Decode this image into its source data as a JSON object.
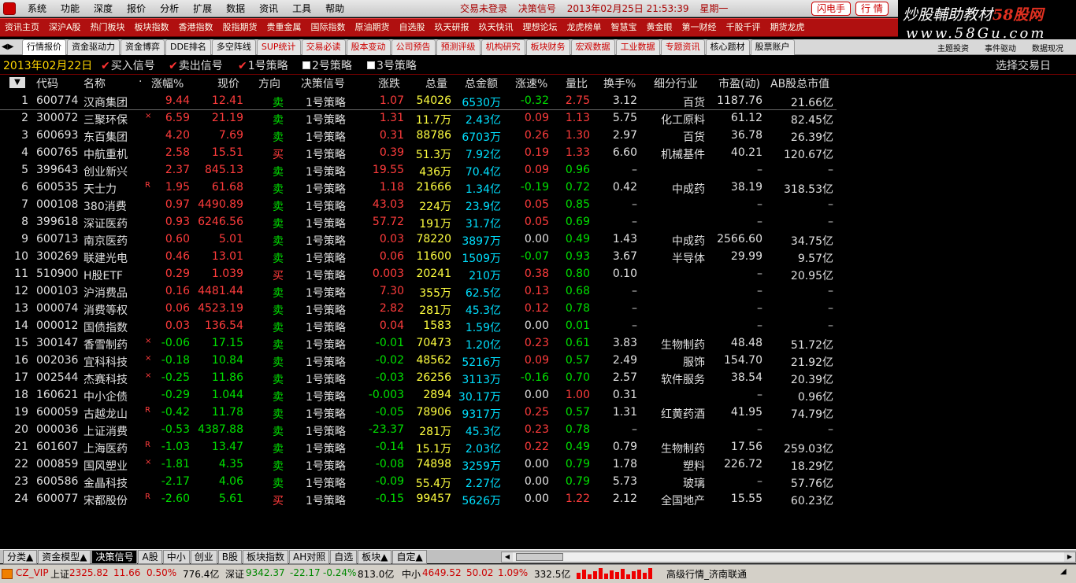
{
  "menu": [
    "系统",
    "功能",
    "深度",
    "报价",
    "分析",
    "扩展",
    "数据",
    "资讯",
    "工具",
    "帮助"
  ],
  "status": {
    "login": "交易未登录",
    "module": "决策信号",
    "datetime": "2013年02月25日  21:53:39",
    "weekday": "星期一"
  },
  "top_buttons": {
    "flash": "闪电手",
    "quote": "行 情"
  },
  "watermark": {
    "line1_a": "炒股輔助教材",
    "line1_b": "58股网",
    "line2": "www.58Gu.com"
  },
  "toolbar": [
    "资讯主页",
    "深沪A股",
    "热门板块",
    "板块指数",
    "香港指数",
    "股指期货",
    "贵重金属",
    "国际指数",
    "原油期货",
    "自选股",
    "玖天研报",
    "玖天快讯",
    "理想论坛",
    "龙虎榜单",
    "智慧宝",
    "黄金眼",
    "第一财经",
    "千股千评",
    "期货龙虎"
  ],
  "tabs": [
    "行情报价",
    "资金驱动力",
    "资金博弈",
    "DDE排名",
    "多空阵线",
    "SUP统计",
    "交易必读",
    "股本变动",
    "公司预告",
    "预测评级",
    "机构研究",
    "板块财务",
    "宏观数据",
    "工业数据",
    "专题资讯",
    "核心题材",
    "股票账户"
  ],
  "tabs_right": [
    "主题投资",
    "事件驱动",
    "数据现况"
  ],
  "dateline": {
    "date": "2013年02月22日",
    "buy": "买入信号",
    "sell": "卖出信号",
    "s1": "1号策略",
    "s2": "2号策略",
    "s3": "3号策略",
    "select_day": "选择交易日"
  },
  "headers": {
    "code": "代码",
    "name": "名称",
    "dot": "·",
    "pct": "涨幅%",
    "price": "现价",
    "dir": "方向",
    "signal": "决策信号",
    "chg": "涨跌",
    "vol": "总量",
    "amt": "总金额",
    "speed": "涨速%",
    "ratio": "量比",
    "turn": "换手%",
    "ind": "细分行业",
    "pe": "市盈(动)",
    "cap": "AB股总市值"
  },
  "rows": [
    {
      "n": "1",
      "code": "600774",
      "name": "汉商集团",
      "flag": "",
      "pct": "9.44",
      "price": "12.41",
      "dir": "卖",
      "sig": "1号策略",
      "chg": "1.07",
      "vol": "54026",
      "amt": "6530万",
      "speed": "-0.32",
      "ratio": "2.75",
      "turn": "3.12",
      "ind": "百货",
      "pe": "1187.76",
      "cap": "21.66亿"
    },
    {
      "n": "2",
      "code": "300072",
      "name": "三聚环保",
      "flag": "×",
      "pct": "6.59",
      "price": "21.19",
      "dir": "卖",
      "sig": "1号策略",
      "chg": "1.31",
      "vol": "11.7万",
      "amt": "2.43亿",
      "speed": "0.09",
      "ratio": "1.13",
      "turn": "5.75",
      "ind": "化工原料",
      "pe": "61.12",
      "cap": "82.45亿"
    },
    {
      "n": "3",
      "code": "600693",
      "name": "东百集团",
      "flag": "",
      "pct": "4.20",
      "price": "7.69",
      "dir": "卖",
      "sig": "1号策略",
      "chg": "0.31",
      "vol": "88786",
      "amt": "6703万",
      "speed": "0.26",
      "ratio": "1.30",
      "turn": "2.97",
      "ind": "百货",
      "pe": "36.78",
      "cap": "26.39亿"
    },
    {
      "n": "4",
      "code": "600765",
      "name": "中航重机",
      "flag": "",
      "pct": "2.58",
      "price": "15.51",
      "dir": "买",
      "sig": "1号策略",
      "chg": "0.39",
      "vol": "51.3万",
      "amt": "7.92亿",
      "speed": "0.19",
      "ratio": "1.33",
      "turn": "6.60",
      "ind": "机械基件",
      "pe": "40.21",
      "cap": "120.67亿"
    },
    {
      "n": "5",
      "code": "399643",
      "name": "创业新兴",
      "flag": "",
      "pct": "2.37",
      "price": "845.13",
      "dir": "卖",
      "sig": "1号策略",
      "chg": "19.55",
      "vol": "436万",
      "amt": "70.4亿",
      "speed": "0.09",
      "ratio": "0.96",
      "turn": "–",
      "ind": "",
      "pe": "–",
      "cap": "–"
    },
    {
      "n": "6",
      "code": "600535",
      "name": "天士力",
      "flag": "R",
      "pct": "1.95",
      "price": "61.68",
      "dir": "卖",
      "sig": "1号策略",
      "chg": "1.18",
      "vol": "21666",
      "amt": "1.34亿",
      "speed": "-0.19",
      "ratio": "0.72",
      "turn": "0.42",
      "ind": "中成药",
      "pe": "38.19",
      "cap": "318.53亿"
    },
    {
      "n": "7",
      "code": "000108",
      "name": "380消费",
      "flag": "",
      "pct": "0.97",
      "price": "4490.89",
      "dir": "卖",
      "sig": "1号策略",
      "chg": "43.03",
      "vol": "224万",
      "amt": "23.9亿",
      "speed": "0.05",
      "ratio": "0.85",
      "turn": "–",
      "ind": "",
      "pe": "–",
      "cap": "–"
    },
    {
      "n": "8",
      "code": "399618",
      "name": "深证医药",
      "flag": "",
      "pct": "0.93",
      "price": "6246.56",
      "dir": "卖",
      "sig": "1号策略",
      "chg": "57.72",
      "vol": "191万",
      "amt": "31.7亿",
      "speed": "0.05",
      "ratio": "0.69",
      "turn": "–",
      "ind": "",
      "pe": "–",
      "cap": "–"
    },
    {
      "n": "9",
      "code": "600713",
      "name": "南京医药",
      "flag": "",
      "pct": "0.60",
      "price": "5.01",
      "dir": "卖",
      "sig": "1号策略",
      "chg": "0.03",
      "vol": "78220",
      "amt": "3897万",
      "speed": "0.00",
      "ratio": "0.49",
      "turn": "1.43",
      "ind": "中成药",
      "pe": "2566.60",
      "cap": "34.75亿"
    },
    {
      "n": "10",
      "code": "300269",
      "name": "联建光电",
      "flag": "",
      "pct": "0.46",
      "price": "13.01",
      "dir": "卖",
      "sig": "1号策略",
      "chg": "0.06",
      "vol": "11600",
      "amt": "1509万",
      "speed": "-0.07",
      "ratio": "0.93",
      "turn": "3.67",
      "ind": "半导体",
      "pe": "29.99",
      "cap": "9.57亿"
    },
    {
      "n": "11",
      "code": "510900",
      "name": "H股ETF",
      "flag": "",
      "pct": "0.29",
      "price": "1.039",
      "dir": "买",
      "sig": "1号策略",
      "chg": "0.003",
      "vol": "20241",
      "amt": "210万",
      "speed": "0.38",
      "ratio": "0.80",
      "turn": "0.10",
      "ind": "",
      "pe": "–",
      "cap": "20.95亿"
    },
    {
      "n": "12",
      "code": "000103",
      "name": "沪消费品",
      "flag": "",
      "pct": "0.16",
      "price": "4481.44",
      "dir": "卖",
      "sig": "1号策略",
      "chg": "7.30",
      "vol": "355万",
      "amt": "62.5亿",
      "speed": "0.13",
      "ratio": "0.68",
      "turn": "–",
      "ind": "",
      "pe": "–",
      "cap": "–"
    },
    {
      "n": "13",
      "code": "000074",
      "name": "消费等权",
      "flag": "",
      "pct": "0.06",
      "price": "4523.19",
      "dir": "卖",
      "sig": "1号策略",
      "chg": "2.82",
      "vol": "281万",
      "amt": "45.3亿",
      "speed": "0.12",
      "ratio": "0.78",
      "turn": "–",
      "ind": "",
      "pe": "–",
      "cap": "–"
    },
    {
      "n": "14",
      "code": "000012",
      "name": "国债指数",
      "flag": "",
      "pct": "0.03",
      "price": "136.54",
      "dir": "卖",
      "sig": "1号策略",
      "chg": "0.04",
      "vol": "1583",
      "amt": "1.59亿",
      "speed": "0.00",
      "ratio": "0.01",
      "turn": "–",
      "ind": "",
      "pe": "–",
      "cap": "–"
    },
    {
      "n": "15",
      "code": "300147",
      "name": "香雪制药",
      "flag": "×",
      "pct": "-0.06",
      "price": "17.15",
      "dir": "卖",
      "sig": "1号策略",
      "chg": "-0.01",
      "vol": "70473",
      "amt": "1.20亿",
      "speed": "0.23",
      "ratio": "0.61",
      "turn": "3.83",
      "ind": "生物制药",
      "pe": "48.48",
      "cap": "51.72亿"
    },
    {
      "n": "16",
      "code": "002036",
      "name": "宜科科技",
      "flag": "×",
      "pct": "-0.18",
      "price": "10.84",
      "dir": "卖",
      "sig": "1号策略",
      "chg": "-0.02",
      "vol": "48562",
      "amt": "5216万",
      "speed": "0.09",
      "ratio": "0.57",
      "turn": "2.49",
      "ind": "服饰",
      "pe": "154.70",
      "cap": "21.92亿"
    },
    {
      "n": "17",
      "code": "002544",
      "name": "杰赛科技",
      "flag": "×",
      "pct": "-0.25",
      "price": "11.86",
      "dir": "卖",
      "sig": "1号策略",
      "chg": "-0.03",
      "vol": "26256",
      "amt": "3113万",
      "speed": "-0.16",
      "ratio": "0.70",
      "turn": "2.57",
      "ind": "软件服务",
      "pe": "38.54",
      "cap": "20.39亿"
    },
    {
      "n": "18",
      "code": "160621",
      "name": "中小企债",
      "flag": "",
      "pct": "-0.29",
      "price": "1.044",
      "dir": "卖",
      "sig": "1号策略",
      "chg": "-0.003",
      "vol": "2894",
      "amt": "30.17万",
      "speed": "0.00",
      "ratio": "1.00",
      "turn": "0.31",
      "ind": "",
      "pe": "–",
      "cap": "0.96亿"
    },
    {
      "n": "19",
      "code": "600059",
      "name": "古越龙山",
      "flag": "R",
      "pct": "-0.42",
      "price": "11.78",
      "dir": "卖",
      "sig": "1号策略",
      "chg": "-0.05",
      "vol": "78906",
      "amt": "9317万",
      "speed": "0.25",
      "ratio": "0.57",
      "turn": "1.31",
      "ind": "红黄药酒",
      "pe": "41.95",
      "cap": "74.79亿"
    },
    {
      "n": "20",
      "code": "000036",
      "name": "上证消费",
      "flag": "",
      "pct": "-0.53",
      "price": "4387.88",
      "dir": "卖",
      "sig": "1号策略",
      "chg": "-23.37",
      "vol": "281万",
      "amt": "45.3亿",
      "speed": "0.23",
      "ratio": "0.78",
      "turn": "–",
      "ind": "",
      "pe": "–",
      "cap": "–"
    },
    {
      "n": "21",
      "code": "601607",
      "name": "上海医药",
      "flag": "R",
      "pct": "-1.03",
      "price": "13.47",
      "dir": "卖",
      "sig": "1号策略",
      "chg": "-0.14",
      "vol": "15.1万",
      "amt": "2.03亿",
      "speed": "0.22",
      "ratio": "0.49",
      "turn": "0.79",
      "ind": "生物制药",
      "pe": "17.56",
      "cap": "259.03亿"
    },
    {
      "n": "22",
      "code": "000859",
      "name": "国风塑业",
      "flag": "×",
      "pct": "-1.81",
      "price": "4.35",
      "dir": "卖",
      "sig": "1号策略",
      "chg": "-0.08",
      "vol": "74898",
      "amt": "3259万",
      "speed": "0.00",
      "ratio": "0.79",
      "turn": "1.78",
      "ind": "塑料",
      "pe": "226.72",
      "cap": "18.29亿"
    },
    {
      "n": "23",
      "code": "600586",
      "name": "金晶科技",
      "flag": "",
      "pct": "-2.17",
      "price": "4.06",
      "dir": "卖",
      "sig": "1号策略",
      "chg": "-0.09",
      "vol": "55.4万",
      "amt": "2.27亿",
      "speed": "0.00",
      "ratio": "0.79",
      "turn": "5.73",
      "ind": "玻璃",
      "pe": "–",
      "cap": "57.76亿"
    },
    {
      "n": "24",
      "code": "600077",
      "name": "宋都股份",
      "flag": "R",
      "pct": "-2.60",
      "price": "5.61",
      "dir": "买",
      "sig": "1号策略",
      "chg": "-0.15",
      "vol": "99457",
      "amt": "5626万",
      "speed": "0.00",
      "ratio": "1.22",
      "turn": "2.12",
      "ind": "全国地产",
      "pe": "15.55",
      "cap": "60.23亿"
    }
  ],
  "bottom_tabs": [
    "分类▲",
    "资金模型▲",
    "决策信号",
    "A股",
    "中小",
    "创业",
    "B股",
    "板块指数",
    "AH对照",
    "自选",
    "板块▲",
    "自定▲"
  ],
  "statusbar": {
    "vip": "CZ_VIP",
    "sh_label": "上证",
    "sh_val": "2325.82",
    "sh_chg": "11.66",
    "sh_pct": "0.50%",
    "sh_amt": "776.4亿",
    "sz_label": "深证",
    "sz_val": "9342.37",
    "sz_chg": "-22.17",
    "sz_pct": "-0.24%",
    "sz_amt": "813.0亿",
    "zx_label": "中小",
    "zx_val": "4649.52",
    "zx_chg": "50.02",
    "zx_pct": "1.09%",
    "zx_amt": "332.5亿",
    "server": "高级行情_济南联通"
  },
  "colors": {
    "up": "#ff3c3c",
    "down": "#00e000",
    "toolbar": "#b01010",
    "background": "#000000"
  }
}
